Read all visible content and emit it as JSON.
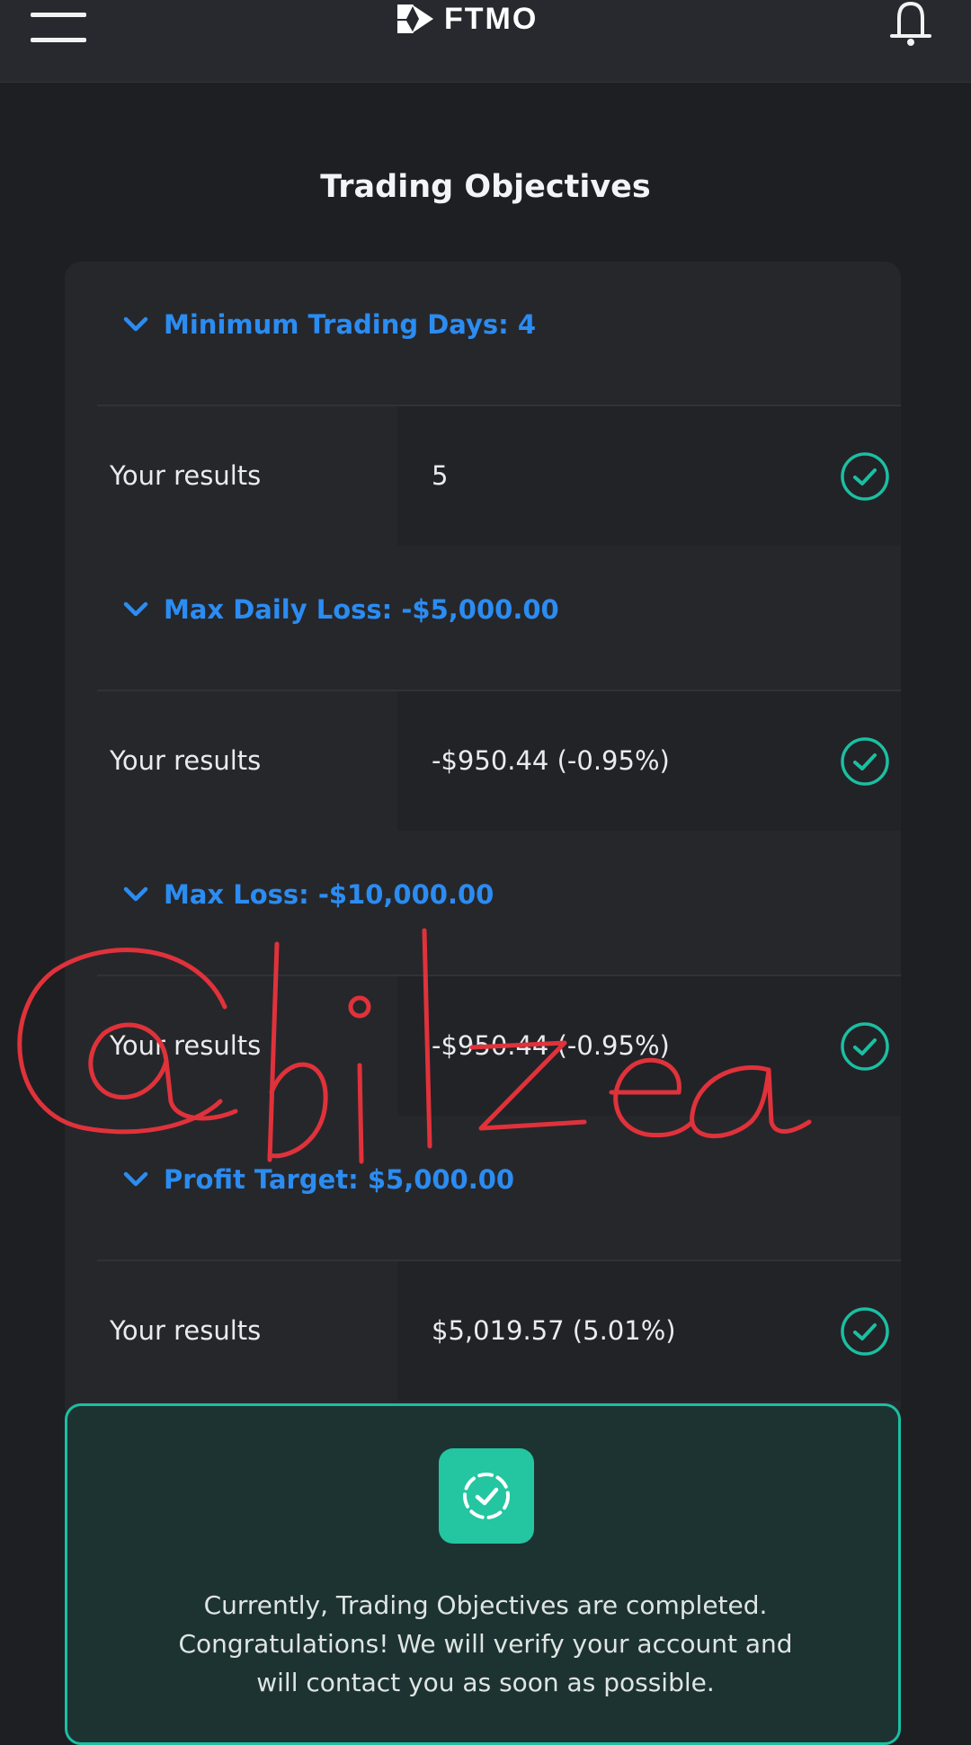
{
  "app": {
    "brand": "FTMO",
    "brand_icon": "ftmo-logo-mark",
    "menu_icon": "hamburger-menu-icon",
    "notification_icon": "bell-icon"
  },
  "page": {
    "title": "Trading Objectives"
  },
  "objectives": [
    {
      "title": "Minimum Trading Days: 4",
      "results_label": "Your results",
      "result": "5",
      "status": "passed"
    },
    {
      "title": "Max Daily Loss: -$5,000.00",
      "results_label": "Your results",
      "result": "-$950.44 (-0.95%)",
      "status": "passed"
    },
    {
      "title": "Max Loss: -$10,000.00",
      "results_label": "Your results",
      "result": "-$950.44 (-0.95%)",
      "status": "passed"
    },
    {
      "title": "Profit Target: $5,000.00",
      "results_label": "Your results",
      "result": "$5,019.57 (5.01%)",
      "status": "passed"
    }
  ],
  "completion": {
    "icon": "completed-check-badge-icon",
    "message_lines": [
      "Currently, Trading Objectives are completed.",
      "Congratulations! We will verify your account and",
      "will contact you as soon as possible."
    ]
  },
  "overlay": {
    "handwritten_watermark": "@bilzea"
  },
  "colors": {
    "accent_blue": "#2b8cf2",
    "success_teal": "#1bbfa2",
    "watermark_red": "#e0323b"
  }
}
